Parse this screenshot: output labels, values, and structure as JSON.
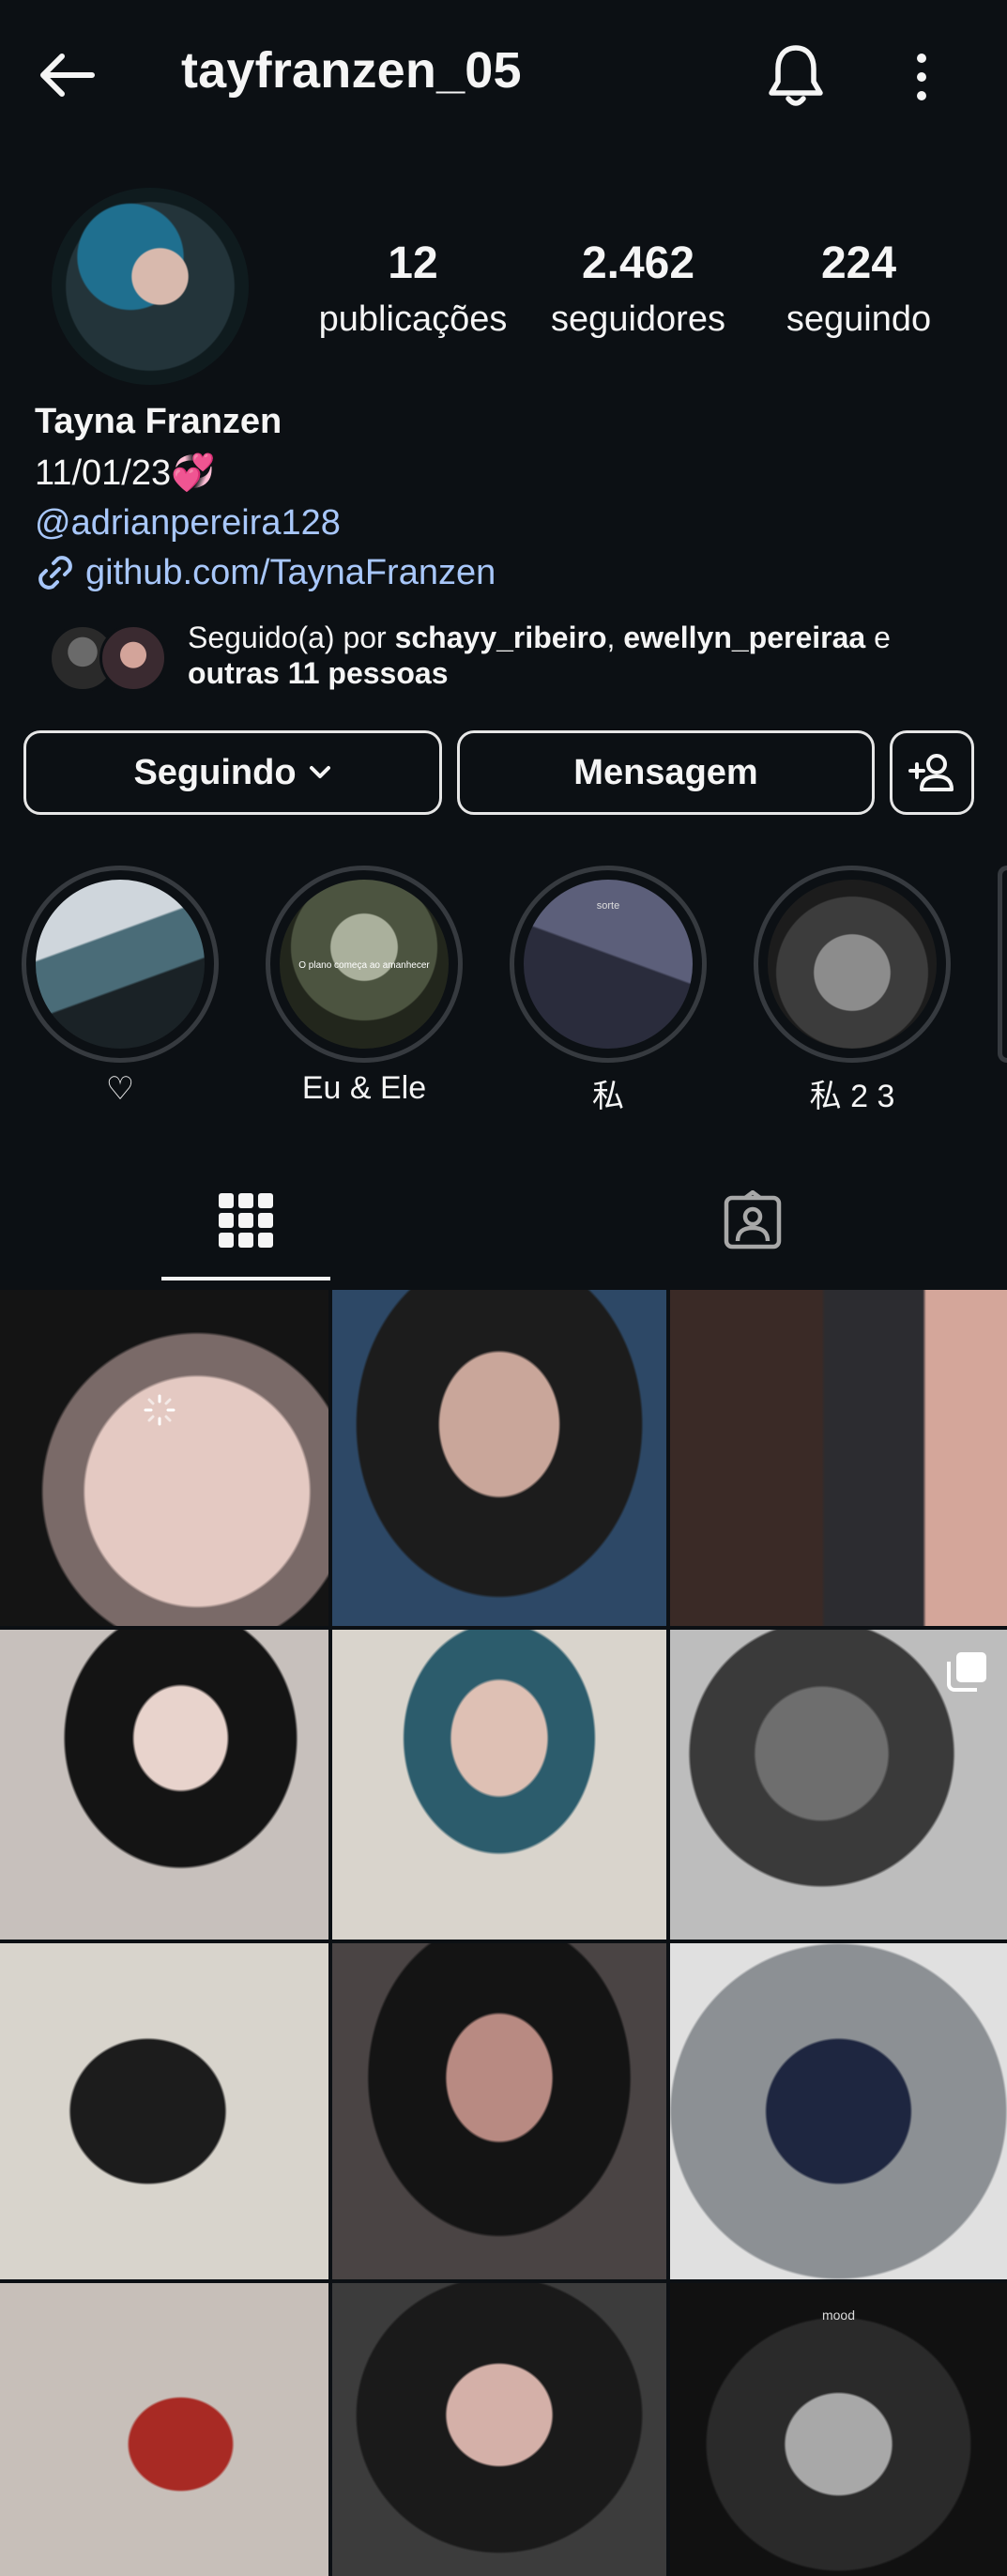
{
  "header": {
    "username": "tayfranzen_05",
    "back_icon": "arrow-left-icon",
    "bell_icon": "bell-icon",
    "more_icon": "more-vertical-icon"
  },
  "stats": {
    "posts": {
      "value": "12",
      "label": "publicações"
    },
    "followers": {
      "value": "2.462",
      "label": "seguidores"
    },
    "following": {
      "value": "224",
      "label": "seguindo"
    }
  },
  "bio": {
    "name": "Tayna Franzen",
    "date_line": "11/01/23💞",
    "mention": "@adrianpereira128",
    "link": "github.com/TaynaFranzen",
    "link_icon": "link-icon"
  },
  "followed_by": {
    "prefix": "Seguido(a) por ",
    "user1": "schayy_ribeiro",
    "sep": ", ",
    "user2": "ewellyn_pereiraa",
    "suffix_e": " e",
    "others": "outras 11 pessoas"
  },
  "actions": {
    "following_label": "Seguindo",
    "message_label": "Mensagem",
    "add_user_icon": "add-person-icon"
  },
  "highlights": [
    {
      "label": "♡"
    },
    {
      "label": "Eu & Ele"
    },
    {
      "label": "私"
    },
    {
      "label": "私 2 3"
    }
  ],
  "highlight_texts": {
    "h2": "O plano começa ao amanhecer",
    "h3": "sorte"
  },
  "tabs": [
    {
      "name": "grid",
      "icon": "grid-icon",
      "selected": true
    },
    {
      "name": "tagged",
      "icon": "tagged-person-icon",
      "selected": false
    }
  ],
  "grid_tile_text": {
    "mood": "mood"
  },
  "colors": {
    "background": "#0c1014",
    "link": "#a8c7fa",
    "text": "#f5f5f5"
  }
}
